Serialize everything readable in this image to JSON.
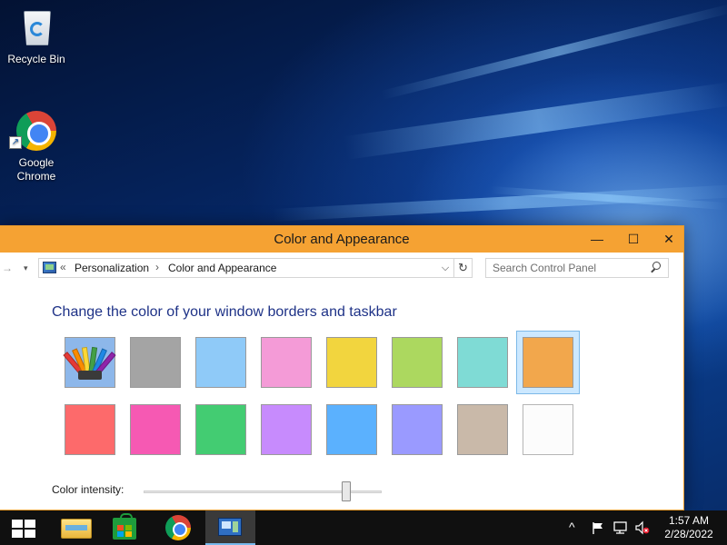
{
  "desktop": {
    "icons": [
      {
        "label": "Recycle Bin"
      },
      {
        "label": "Google Chrome"
      }
    ]
  },
  "window": {
    "title": "Color and Appearance",
    "controls": {
      "minimize": "—",
      "maximize": "☐",
      "close": "✕"
    },
    "address": {
      "overflow": "«",
      "crumbs": [
        "Personalization",
        "Color and Appearance"
      ],
      "separator": "›"
    },
    "search": {
      "placeholder": "Search Control Panel"
    },
    "heading": "Change the color of your window borders and taskbar",
    "swatches": [
      {
        "name": "automatic",
        "color": "#7fa9e0"
      },
      {
        "name": "sky",
        "color": "#a4a4a4"
      },
      {
        "name": "twilight",
        "color": "#8fcaf8"
      },
      {
        "name": "sea foam",
        "color": "#f49bd7"
      },
      {
        "name": "lime",
        "color": "#f2d53e"
      },
      {
        "name": "leaf",
        "color": "#acd85f"
      },
      {
        "name": "emerald",
        "color": "#7fdbd5"
      },
      {
        "name": "tangerine",
        "color": "#f2a74c"
      },
      {
        "name": "blush",
        "color": "#fd6a6b"
      },
      {
        "name": "magenta",
        "color": "#f659b3"
      },
      {
        "name": "green",
        "color": "#43cc72"
      },
      {
        "name": "lavender",
        "color": "#c78bfd"
      },
      {
        "name": "blue",
        "color": "#5bb1fe"
      },
      {
        "name": "violet",
        "color": "#9a9aff"
      },
      {
        "name": "taupe",
        "color": "#c9b9a9"
      },
      {
        "name": "frost",
        "color": "#fcfcfc"
      }
    ],
    "selected_swatch_index": 7,
    "intensity": {
      "label": "Color intensity:",
      "level": 0.85
    }
  },
  "taskbar": {
    "items": [
      "start-button",
      "file-explorer",
      "store",
      "google-chrome",
      "control-panel"
    ],
    "active_item": "control-panel",
    "tray": {
      "chevron": "^"
    },
    "clock": {
      "time": "1:57 AM",
      "date": "2/28/2022"
    }
  },
  "colors": {
    "titlebar": "#f5a233",
    "heading": "#1e3287",
    "taskbar": "#101010"
  }
}
